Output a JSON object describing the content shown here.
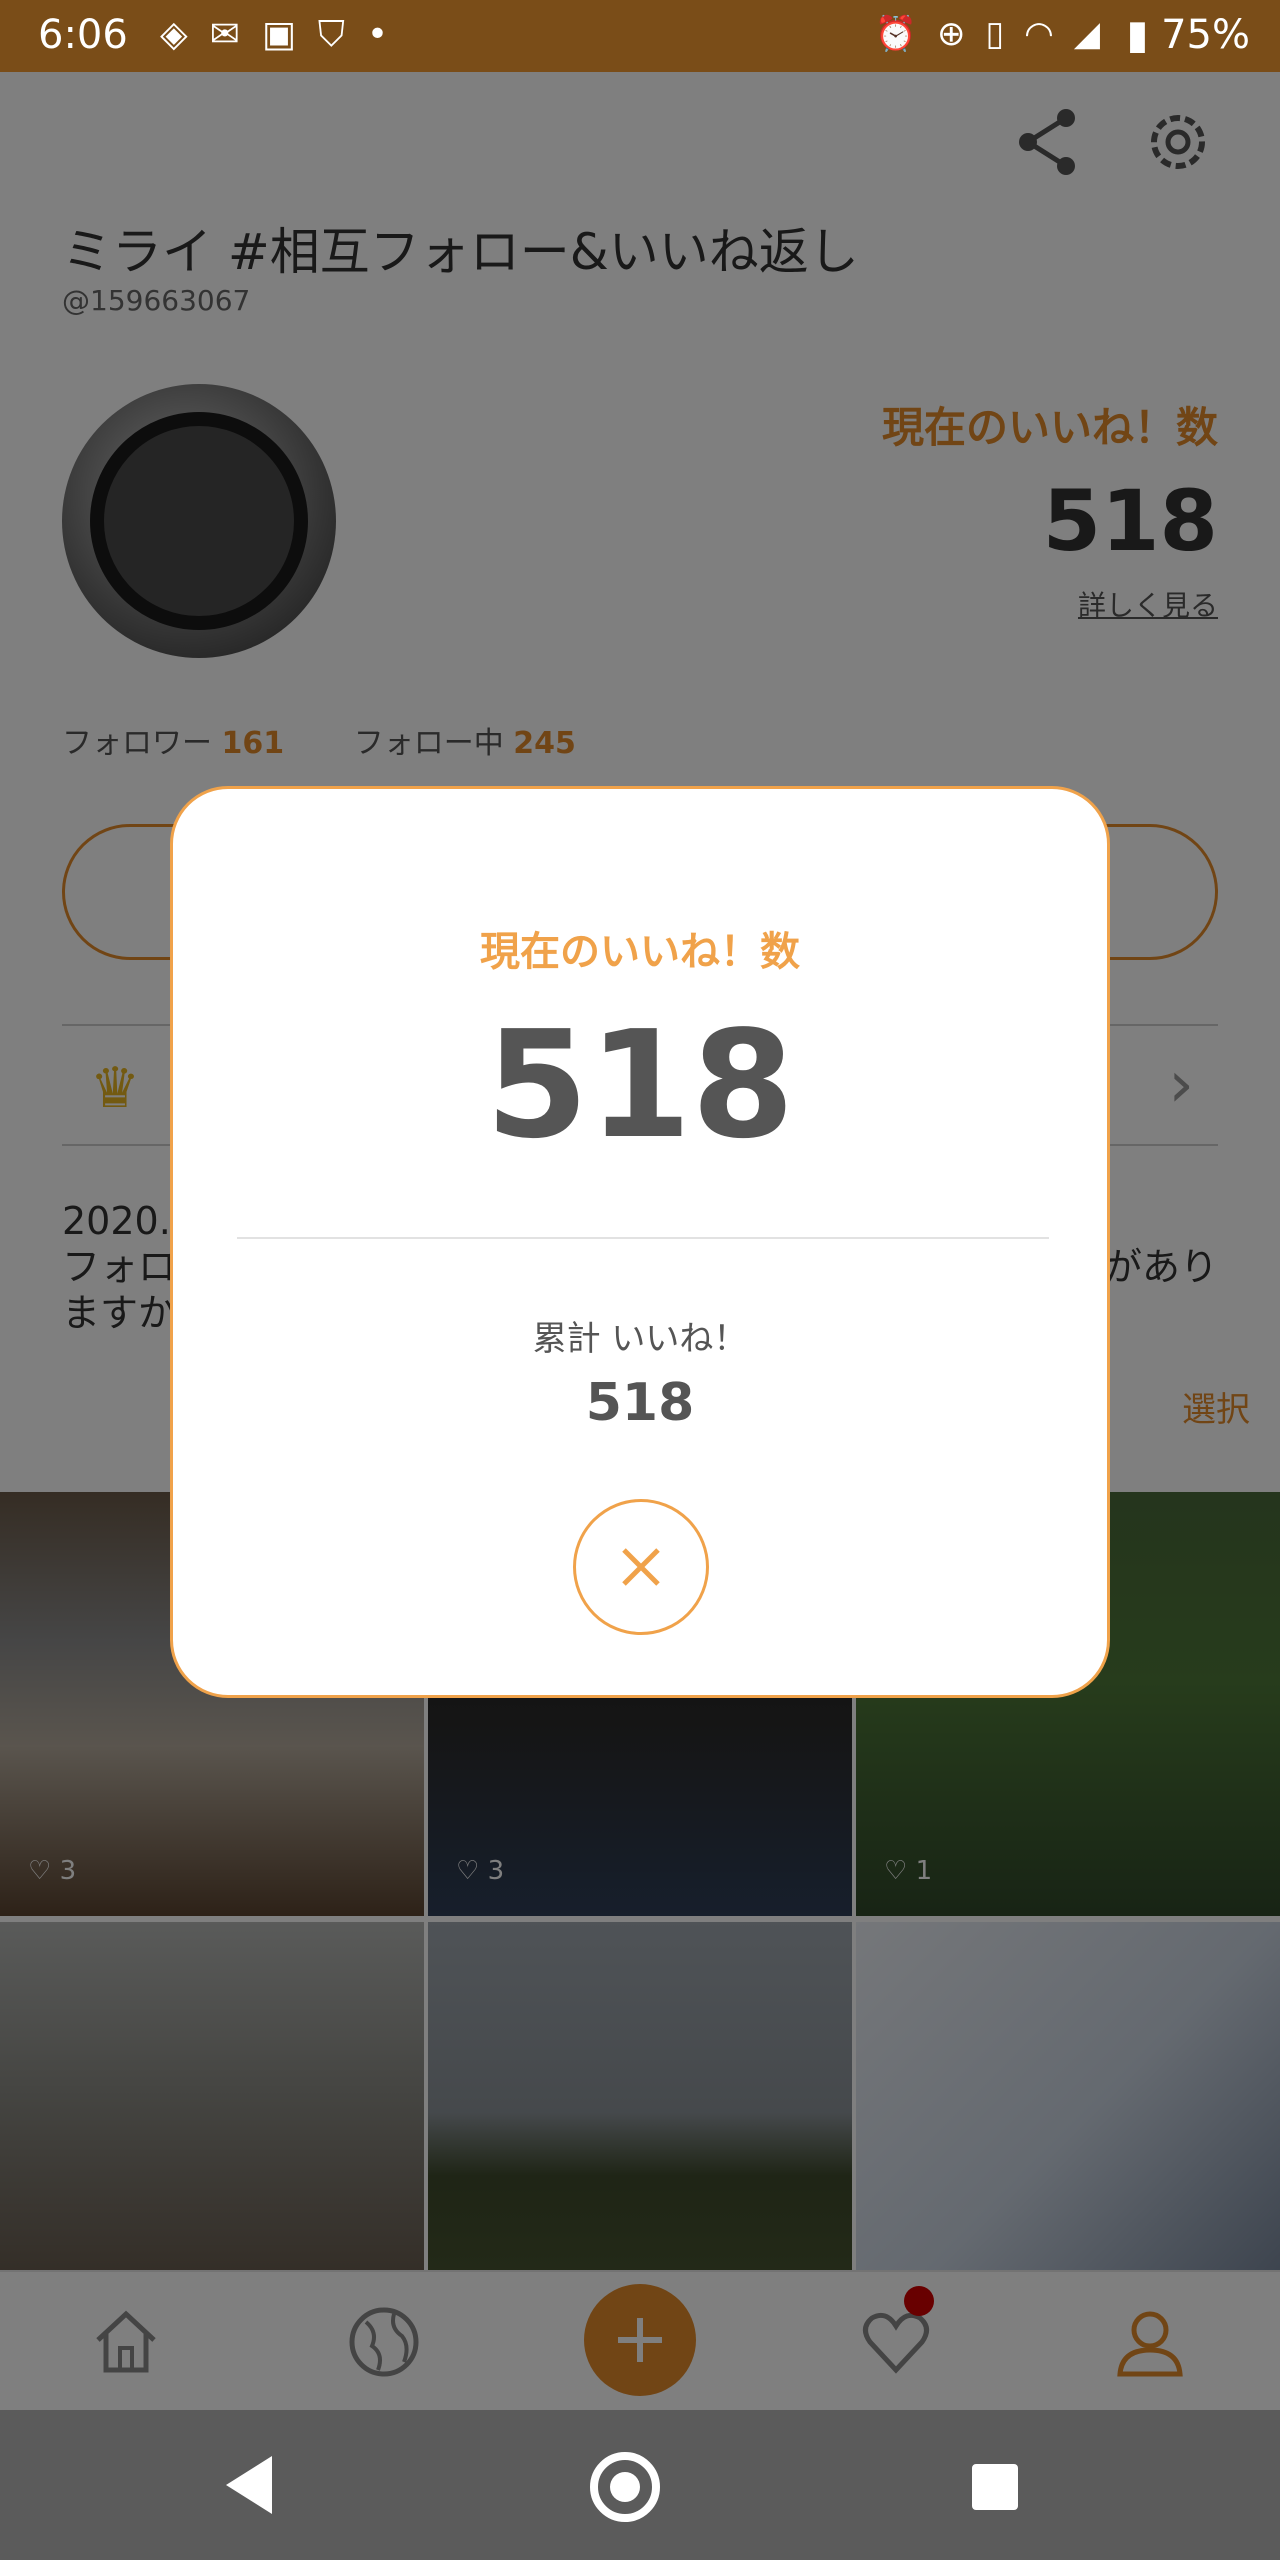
{
  "status_bar": {
    "time": "6:06",
    "battery_pct": "75%"
  },
  "profile": {
    "name": "ミライ #相互フォロー&いいね返し",
    "user_id": "@159663067",
    "likes_label": "現在のいいね！数",
    "likes_value": "518",
    "likes_detail_link": "詳しく見る",
    "followers_label": "フォロワー",
    "followers_count": "161",
    "following_label": "フォロー中",
    "following_count": "245",
    "bio_line1_left": "2020.",
    "bio_line2_left": "フォロ",
    "bio_line3_left": "ますか",
    "bio_line2_right": "があり",
    "select_label": "選択"
  },
  "photos": [
    {
      "likes": "3"
    },
    {
      "likes": "3"
    },
    {
      "likes": "1"
    },
    {
      "likes": ""
    },
    {
      "likes": ""
    },
    {
      "likes": ""
    }
  ],
  "modal": {
    "title": "現在のいいね！数",
    "count": "518",
    "total_label": "累計 いいね！",
    "total_value": "518"
  },
  "colors": {
    "accent": "#e38a2b",
    "modal_accent": "#f0a24a",
    "status_bar": "#7a4d18",
    "notification": "#d00000"
  },
  "icons": {
    "header": [
      "share-icon",
      "gear-icon"
    ],
    "bottom_nav": [
      "home-icon",
      "globe-icon",
      "plus-icon",
      "heart-icon",
      "user-icon"
    ],
    "modal": [
      "close-icon"
    ]
  }
}
